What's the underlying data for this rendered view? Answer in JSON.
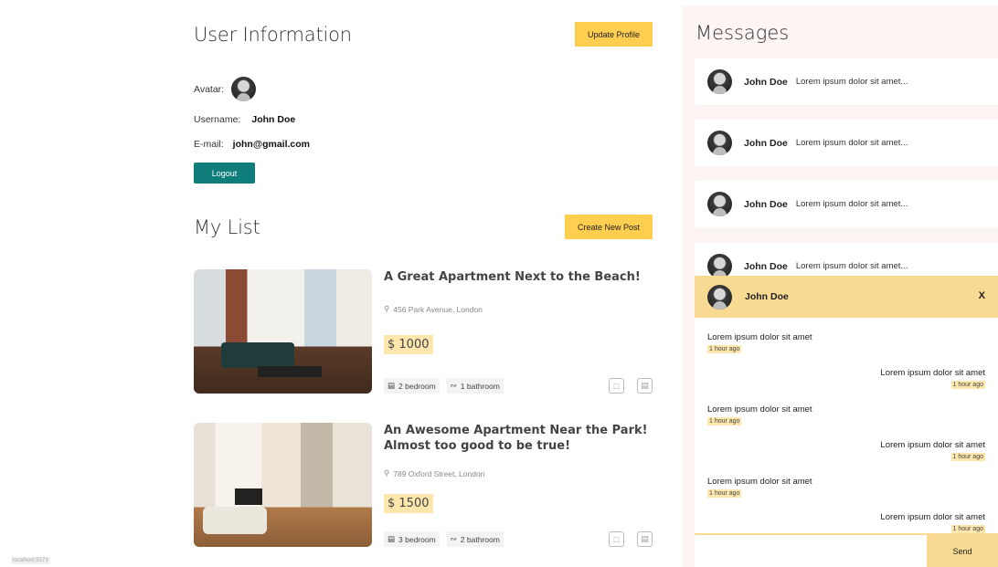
{
  "user_info": {
    "title": "User Information",
    "update_button": "Update Profile",
    "avatar_label": "Avatar:",
    "username_label": "Username:",
    "username": "John Doe",
    "email_label": "E-mail:",
    "email": "john@gmail.com",
    "logout_button": "Logout"
  },
  "my_list": {
    "title": "My List",
    "create_button": "Create New Post",
    "posts": [
      {
        "title": "A Great Apartment Next to the Beach!",
        "address": "456 Park Avenue, London",
        "price": "$ 1000",
        "bedroom": "2 bedroom",
        "bathroom": "1 bathroom"
      },
      {
        "title": "An Awesome Apartment Near the Park! Almost too good to be true!",
        "address": "789 Oxford Street, London",
        "price": "$ 1500",
        "bedroom": "3 bedroom",
        "bathroom": "2 bathroom"
      }
    ]
  },
  "messages": {
    "title": "Messages",
    "items": [
      {
        "name": "John Doe",
        "preview": "Lorem ipsum dolor sit amet..."
      },
      {
        "name": "John Doe",
        "preview": "Lorem ipsum dolor sit amet..."
      },
      {
        "name": "John Doe",
        "preview": "Lorem ipsum dolor sit amet..."
      },
      {
        "name": "John Doe",
        "preview": "Lorem ipsum dolor sit amet..."
      }
    ]
  },
  "chat": {
    "name": "John Doe",
    "close": "X",
    "messages": [
      {
        "text": "Lorem ipsum dolor sit amet",
        "time": "1 hour ago",
        "own": false
      },
      {
        "text": "Lorem ipsum dolor sit amet",
        "time": "1 hour ago",
        "own": true
      },
      {
        "text": "Lorem ipsum dolor sit amet",
        "time": "1 hour ago",
        "own": false
      },
      {
        "text": "Lorem ipsum dolor sit amet",
        "time": "1 hour ago",
        "own": true
      },
      {
        "text": "Lorem ipsum dolor sit amet",
        "time": "1 hour ago",
        "own": false
      },
      {
        "text": "Lorem ipsum dolor sit amet",
        "time": "1 hour ago",
        "own": true
      }
    ],
    "send_button": "Send"
  },
  "footer_url": "localhost:5173"
}
